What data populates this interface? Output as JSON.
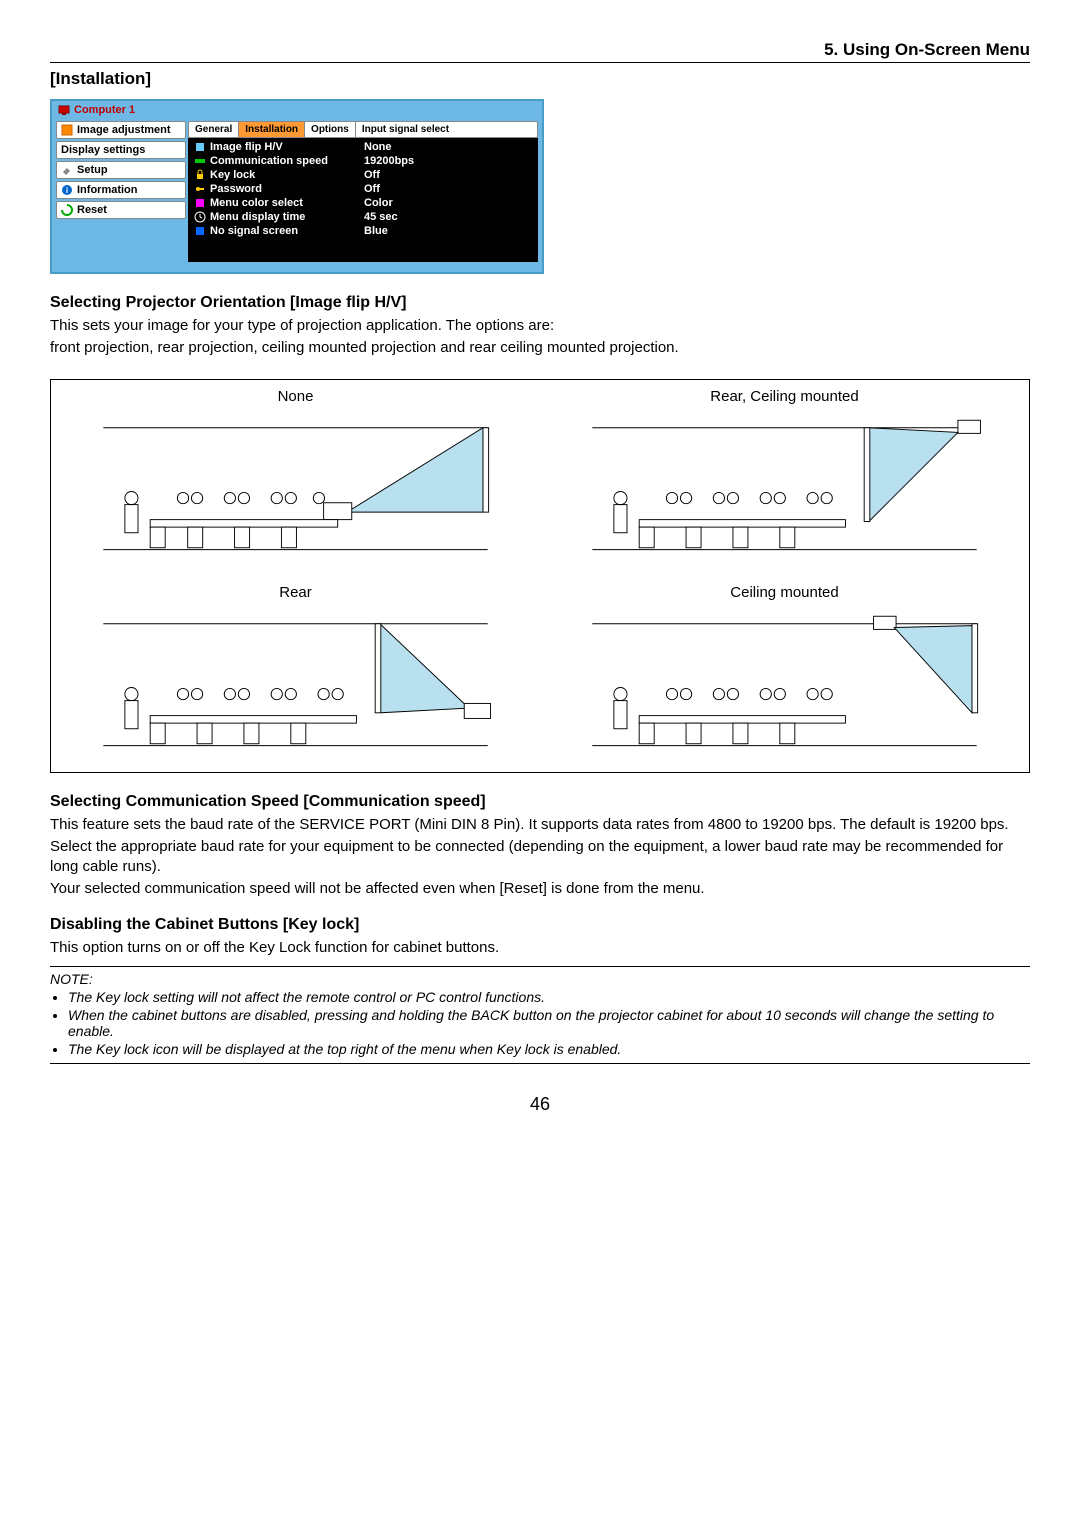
{
  "header": {
    "chapter": "5. Using On-Screen Menu"
  },
  "section": "[Installation]",
  "osd": {
    "title": "Computer 1",
    "sidebar": [
      "Image adjustment",
      "Display settings",
      "Setup",
      "Information",
      "Reset"
    ],
    "tabs": [
      "General",
      "Installation",
      "Options",
      "Input signal select"
    ],
    "rows": [
      {
        "label": "Image flip H/V",
        "value": "None"
      },
      {
        "label": "Communication speed",
        "value": "19200bps"
      },
      {
        "label": "Key lock",
        "value": "Off"
      },
      {
        "label": "Password",
        "value": "Off"
      },
      {
        "label": "Menu color select",
        "value": "Color"
      },
      {
        "label": "Menu display time",
        "value": "45 sec"
      },
      {
        "label": "No signal screen",
        "value": "Blue"
      }
    ]
  },
  "s1": {
    "heading": "Selecting Projector Orientation [Image flip H/V]",
    "p1": "This sets your image for your type of projection application. The options are:",
    "p2": "front projection, rear projection, ceiling mounted projection and rear ceiling mounted projection."
  },
  "orient": {
    "tl": "None",
    "tr": "Rear, Ceiling mounted",
    "bl": "Rear",
    "br": "Ceiling mounted"
  },
  "s2": {
    "heading": "Selecting Communication Speed [Communication speed]",
    "p1": "This feature sets the baud rate of the SERVICE PORT (Mini DIN 8 Pin). It supports data rates from 4800 to 19200 bps. The default is 19200 bps.",
    "p2": "Select the appropriate baud rate for your equipment to be connected (depending on the equipment, a lower baud rate may be recommended for long cable runs).",
    "p3": "Your selected communication speed will not be affected even when [Reset] is done from the menu."
  },
  "s3": {
    "heading": "Disabling the Cabinet Buttons [Key lock]",
    "p1": "This option turns on or off the Key Lock function for cabinet buttons."
  },
  "note": {
    "title": "NOTE:",
    "b1": "The Key lock setting will not affect the remote control or PC control functions.",
    "b2": "When the cabinet buttons are disabled, pressing and holding the BACK button on the projector cabinet for about 10 seconds will change the setting to enable.",
    "b3": "The Key lock icon will be displayed at the top right of the menu when Key lock is enabled."
  },
  "page": "46"
}
